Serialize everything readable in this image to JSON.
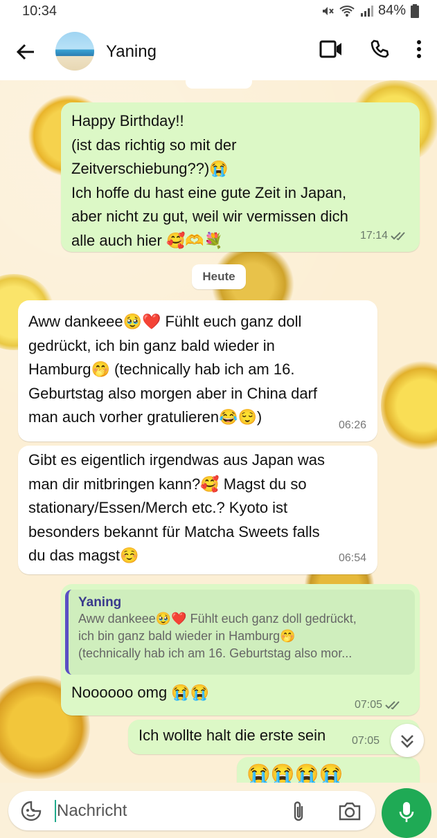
{
  "status_bar": {
    "time": "10:34",
    "battery": "84%"
  },
  "contact": {
    "name": "Yaning"
  },
  "messages": [
    {
      "text": "Happy Birthday!!\n(ist das richtig so mit der\nZeitverschiebung??)😭\nIch hoffe du hast eine gute Zeit in Japan,\naber nicht zu gut, weil wir vermissen dich\nalle auch hier 🥰🫶💐",
      "time": "17:14"
    },
    {
      "text": "Aww dankeee🥹❤️ Fühlt euch ganz doll\ngedrückt, ich bin ganz bald wieder in\nHamburg🤭 (technically hab ich am 16.\nGeburtstag also morgen aber in China darf\nman auch vorher gratulieren😂😌)",
      "time": "06:26"
    },
    {
      "text": "Gibt es eigentlich irgendwas aus Japan was\nman dir mitbringen kann?🥰 Magst du so\nstationary/Essen/Merch etc.? Kyoto ist\nbesonders bekannt für Matcha Sweets falls\ndu das magst☺️",
      "time": "06:54"
    },
    {
      "quote_name": "Yaning",
      "quote_text": "Aww dankeee🥹❤️ Fühlt euch ganz doll gedrückt,\nich bin ganz bald wieder in Hamburg🤭\n(technically hab ich am 16. Geburtstag also mor...",
      "text": "Noooooo omg 😭😭",
      "time": "07:05"
    },
    {
      "text": "Ich wollte halt die erste sein",
      "time": "07:05"
    },
    {
      "text": "😭😭😭😭"
    }
  ],
  "day_separator": "Heute",
  "input": {
    "placeholder": "Nachricht"
  }
}
